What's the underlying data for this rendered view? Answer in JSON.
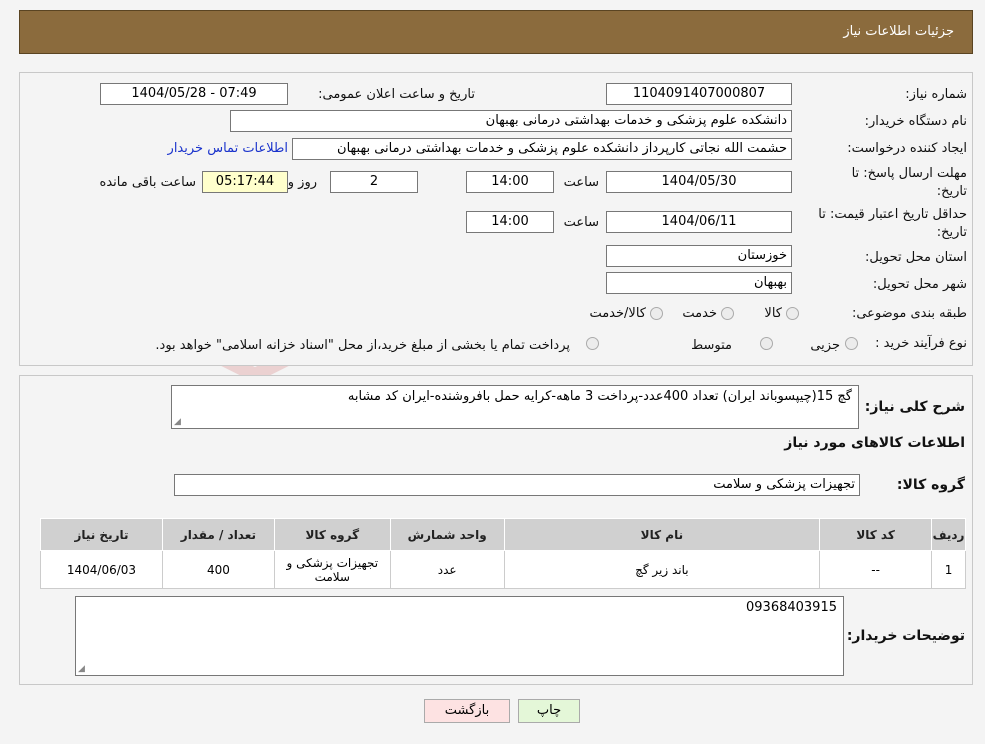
{
  "header": {
    "title": "جزئیات اطلاعات نیاز"
  },
  "form": {
    "need_number_label": "شماره نیاز:",
    "need_number": "1104091407000807",
    "announce_label": "تاریخ و ساعت اعلان عمومی:",
    "announce_value": "1404/05/28 - 07:49",
    "buyer_org_label": "نام دستگاه خریدار:",
    "buyer_org": "دانشکده علوم پزشکی و خدمات بهداشتی  درمانی بهبهان",
    "creator_label": "ایجاد کننده درخواست:",
    "creator": "حشمت الله نجاتی کارپرداز دانشکده علوم پزشکی و خدمات بهداشتی  درمانی بهبهان",
    "contact_link": "اطلاعات تماس خریدار",
    "deadline_label_1": "مهلت ارسال پاسخ: تا",
    "deadline_label_2": "تاریخ:",
    "deadline_date": "1404/05/30",
    "hour_label": "ساعت",
    "deadline_time": "14:00",
    "days_value": "2",
    "days_label": "روز و",
    "remaining_time": "05:17:44",
    "remaining_label": "ساعت باقی مانده",
    "validity_label_1": "حداقل تاریخ اعتبار قیمت: تا",
    "validity_label_2": "تاریخ:",
    "validity_date": "1404/06/11",
    "validity_time": "14:00",
    "province_label": "استان محل تحویل:",
    "province": "خوزستان",
    "city_label": "شهر محل تحویل:",
    "city": "بهبهان",
    "category_label": "طبقه بندی موضوعی:",
    "category_options": [
      "کالا",
      "خدمت",
      "کالا/خدمت"
    ],
    "process_label": "نوع فرآیند خرید :",
    "process_options": [
      "جزیی",
      "متوسط"
    ],
    "process_note": "پرداخت تمام یا بخشی از مبلغ خرید،از محل \"اسناد خزانه اسلامی\" خواهد بود."
  },
  "description": {
    "label": "شرح کلی نیاز:",
    "text": "گچ 15(چیپسوباند ایران) تعداد 400عدد-پرداخت 3 ماهه-کرایه حمل بافروشنده-ایران کد مشابه"
  },
  "goods": {
    "section_title": "اطلاعات کالاهای مورد نیاز",
    "group_label": "گروه کالا:",
    "group_value": "تجهیزات پزشکی و سلامت",
    "table_headers": [
      "ردیف",
      "کد کالا",
      "نام کالا",
      "واحد شمارش",
      "گروه کالا",
      "تعداد / مقدار",
      "تاریخ نیاز"
    ],
    "rows": [
      {
        "row": "1",
        "code": "--",
        "name": "باند زیر گچ",
        "unit": "عدد",
        "group": "تجهیزات پزشکی و سلامت",
        "qty": "400",
        "date": "1404/06/03"
      }
    ]
  },
  "buyer_notes": {
    "label": "توضیحات خریدار:",
    "text": "09368403915"
  },
  "buttons": {
    "print": "چاپ",
    "back": "بازگشت"
  },
  "colors": {
    "header_bg": "#8b6b3d",
    "link": "#1a33cc",
    "print_bg": "#e4f7d8",
    "back_bg": "#fde2e2"
  }
}
